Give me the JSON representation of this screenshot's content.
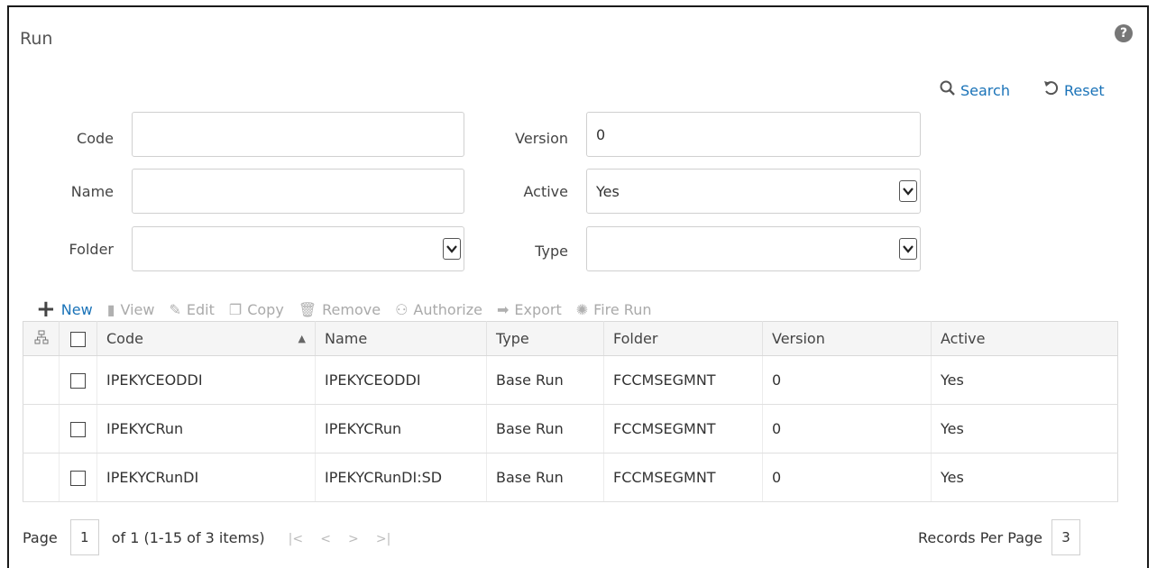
{
  "title": "Run",
  "header_actions": {
    "search": {
      "label": "Search",
      "icon": "search-icon"
    },
    "reset": {
      "label": "Reset",
      "icon": "reset-icon"
    }
  },
  "form": {
    "code": {
      "label": "Code",
      "value": ""
    },
    "version": {
      "label": "Version",
      "value": "0"
    },
    "name": {
      "label": "Name",
      "value": ""
    },
    "active": {
      "label": "Active",
      "value": "Yes"
    },
    "folder": {
      "label": "Folder",
      "value": ""
    },
    "type": {
      "label": "Type",
      "value": ""
    }
  },
  "toolbar": {
    "new": "New",
    "view": "View",
    "edit": "Edit",
    "copy": "Copy",
    "remove": "Remove",
    "authorize": "Authorize",
    "export": "Export",
    "fire_run": "Fire Run"
  },
  "table": {
    "columns": [
      "Code",
      "Name",
      "Type",
      "Folder",
      "Version",
      "Active"
    ],
    "rows": [
      [
        "IPEKYCEODDI",
        "IPEKYCEODDI",
        "Base Run",
        "FCCMSEGMNT",
        "0",
        "Yes"
      ],
      [
        "IPEKYCRun",
        "IPEKYCRun",
        "Base Run",
        "FCCMSEGMNT",
        "0",
        "Yes"
      ],
      [
        "IPEKYCRunDI",
        "IPEKYCRunDI:SD",
        "Base Run",
        "FCCMSEGMNT",
        "0",
        "Yes"
      ]
    ]
  },
  "pagination": {
    "page_label": "Page",
    "page": "1",
    "of_text": "of 1 (1-15 of 3 items)",
    "records_label": "Records Per Page",
    "records_per_page": "3"
  },
  "colors": {
    "link": "#1a73b8",
    "header_bg": "#f5f5f5",
    "border": "#d9d9d9"
  }
}
